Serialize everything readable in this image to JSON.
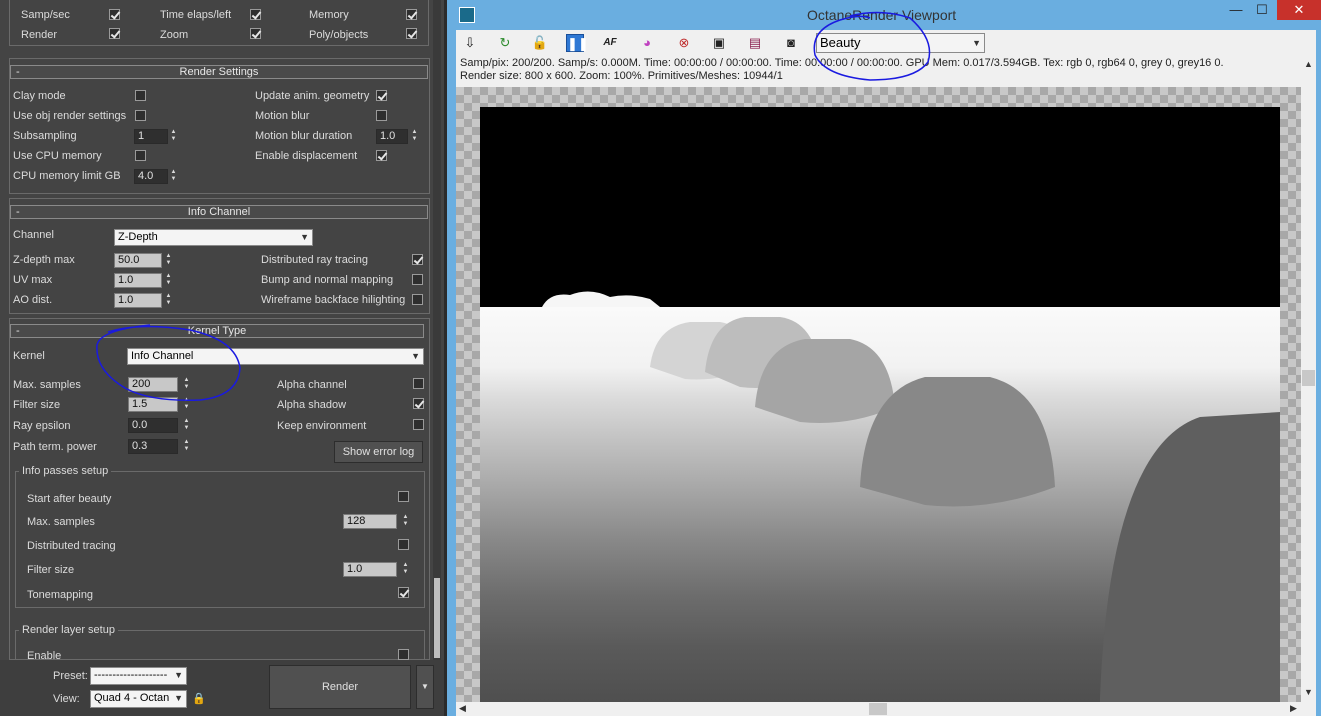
{
  "left_panel": {
    "top_rows": [
      {
        "items": [
          {
            "label": "Samp/sec",
            "checked": true
          },
          {
            "label": "Time elaps/left",
            "checked": true
          },
          {
            "label": "Memory",
            "checked": true
          }
        ]
      },
      {
        "items": [
          {
            "label": "Render",
            "checked": true
          },
          {
            "label": "Zoom",
            "checked": true
          },
          {
            "label": "Poly/objects",
            "checked": true
          }
        ]
      }
    ],
    "render_settings": {
      "title": "Render Settings",
      "clay_mode": "Clay mode",
      "use_obj_render_settings": "Use obj render settings",
      "subsampling": "Subsampling",
      "subsampling_value": "1",
      "use_cpu_memory": "Use CPU memory",
      "cpu_memory_limit": "CPU memory limit GB",
      "cpu_memory_value": "4.0",
      "update_anim_geometry": "Update anim. geometry",
      "motion_blur": "Motion blur",
      "motion_blur_duration": "Motion blur duration",
      "motion_blur_duration_value": "1.0",
      "enable_displacement": "Enable displacement"
    },
    "info_channel": {
      "title": "Info Channel",
      "channel_label": "Channel",
      "channel_value": "Z-Depth",
      "zdepth_max": "Z-depth max",
      "zdepth_max_value": "50.0",
      "uv_max": "UV max",
      "uv_max_value": "1.0",
      "ao_dist": "AO dist.",
      "ao_dist_value": "1.0",
      "distributed_ray_tracing": "Distributed ray tracing",
      "bump_normal_mapping": "Bump and normal mapping",
      "wireframe_backface": "Wireframe backface hilighting"
    },
    "kernel_type": {
      "title": "Kernel Type",
      "kernel_label": "Kernel",
      "kernel_value": "Info Channel",
      "max_samples": "Max. samples",
      "max_samples_value": "200",
      "filter_size": "Filter size",
      "filter_size_value": "1.5",
      "ray_epsilon": "Ray epsilon",
      "ray_epsilon_value": "0.0",
      "path_term_power": "Path term. power",
      "path_term_power_value": "0.3",
      "alpha_channel": "Alpha channel",
      "alpha_shadow": "Alpha shadow",
      "keep_environment": "Keep environment",
      "show_error_log": "Show error log"
    },
    "info_passes": {
      "title": "Info passes setup",
      "start_after_beauty": "Start after beauty",
      "max_samples": "Max. samples",
      "max_samples_value": "128",
      "distributed_tracing": "Distributed tracing",
      "filter_size": "Filter size",
      "filter_size_value": "1.0",
      "tonemapping": "Tonemapping"
    },
    "render_layer": {
      "title": "Render layer setup",
      "enable": "Enable"
    },
    "bottom": {
      "preset_label": "Preset:",
      "preset_value": "--------------------",
      "view_label": "View:",
      "view_value": "Quad 4 - Octan",
      "render_button": "Render"
    }
  },
  "viewport": {
    "title": "OctaneRender Viewport",
    "channel_select": "Beauty",
    "info_line1": "Samp/pix: 200/200.   Samp/s: 0.000M.   Time: 00:00:00 / 00:00:00.   Time: 00:00:00 / 00:00:00.   GPU Mem: 0.017/3.594GB.   Tex: rgb 0, rgb64 0, grey 0, grey16 0.",
    "info_line2": "Render size: 800 x 600.   Zoom: 100%.   Primitives/Meshes: 10944/1",
    "toolbar_icons": [
      "save-icon",
      "refresh-icon",
      "lock-icon",
      "pause-icon",
      "af-icon",
      "color-picker-icon",
      "target-icon",
      "monitor-icon",
      "film-icon",
      "camera-icon"
    ],
    "toolbar_af_text": "AF",
    "accent_color": "#6aaee0"
  }
}
